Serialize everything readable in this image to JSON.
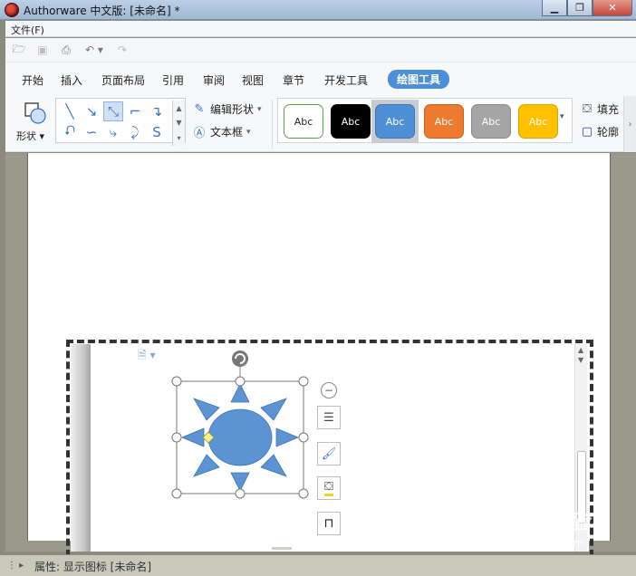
{
  "window": {
    "title": "Authorware 中文版: [未命名] *",
    "minimize_glyph": "▁",
    "restore_glyph": "❐",
    "close_glyph": "✕"
  },
  "menu": {
    "file": "文件(F)"
  },
  "quick_toolbar": [
    {
      "name": "open-icon",
      "glyph": "🗁"
    },
    {
      "name": "save-icon",
      "glyph": "▣"
    },
    {
      "name": "print-icon",
      "glyph": "⎙"
    },
    {
      "name": "undo-icon",
      "glyph": "↶ ▾"
    },
    {
      "name": "redo-icon",
      "glyph": "↷"
    }
  ],
  "tabs": [
    "开始",
    "插入",
    "页面布局",
    "引用",
    "审阅",
    "视图",
    "章节",
    "开发工具",
    "绘图工具"
  ],
  "active_tab_index": 8,
  "ribbon": {
    "shape_label": "形状",
    "edit_shape_label": "编辑形状",
    "textbox_label": "文本框",
    "fill_label": "填充",
    "outline_label": "轮廓",
    "style_text": "Abc",
    "styles": [
      {
        "bg": "#ffffff",
        "border": "#5aa04a",
        "fg": "#222222"
      },
      {
        "bg": "#000000",
        "border": "#000000",
        "fg": "#ffffff"
      },
      {
        "bg": "#4e8fd6",
        "border": "#3c76b8",
        "fg": "#ffffff"
      },
      {
        "bg": "#ee7a30",
        "border": "#c9621f",
        "fg": "#ffffff"
      },
      {
        "bg": "#a5a5a5",
        "border": "#8a8a8a",
        "fg": "#ffffff"
      },
      {
        "bg": "#ffc000",
        "border": "#d9a200",
        "fg": "#ffffff"
      }
    ],
    "selected_style_index": 2
  },
  "status": {
    "text": "属性: 显示图标 [未命名]"
  },
  "watermark": {
    "main": "Baidu经验",
    "sub": "jingyan.baidu.com"
  },
  "colors": {
    "accent": "#4a8fd8",
    "shape_fill": "#5b93d3"
  }
}
